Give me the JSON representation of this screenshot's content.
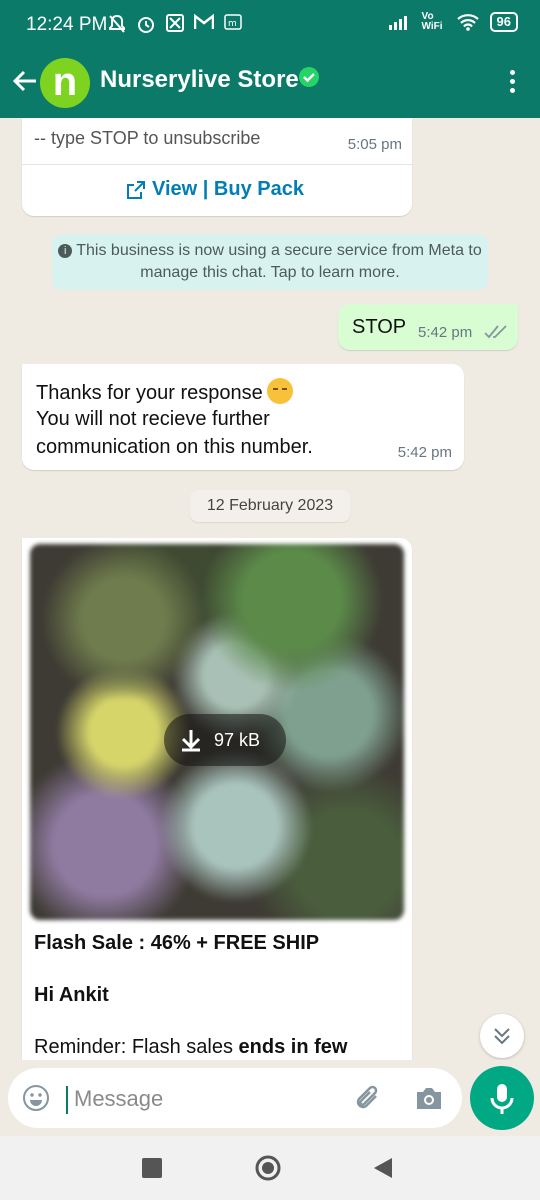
{
  "statusbar": {
    "time": "12:24 PM",
    "battery": "96",
    "left_icons": [
      "mute-icon",
      "alarm-icon",
      "app-icon",
      "gmail-icon",
      "m-icon"
    ],
    "right_icons": [
      "signal-icon",
      "vowifi-icon",
      "wifi-icon",
      "battery-icon"
    ],
    "network_label": "Vo WiFi"
  },
  "header": {
    "avatar_letter": "n",
    "title": "Nurserylive Store",
    "verified": true
  },
  "messages": {
    "unsub": {
      "text": "-- type STOP to unsubscribe",
      "time": "5:05 pm",
      "action_label": "View | Buy Pack"
    },
    "system_note": "This business is now using a secure service from Meta to manage this chat. Tap to learn more.",
    "stop": {
      "text": "STOP",
      "time": "5:42 pm"
    },
    "thanks": {
      "line1": "Thanks for your response",
      "line2": "You will not recieve further",
      "line3": "communication on this number.",
      "time": "5:42 pm"
    },
    "date_chip": "12 February 2023",
    "flash": {
      "download_size": "97 kB",
      "title": "Flash Sale : 46% + FREE SHIP",
      "greeting": "Hi Ankit",
      "reminder_prefix": "Reminder: Flash sales ",
      "reminder_bold": "ends in few"
    }
  },
  "input": {
    "placeholder": "Message"
  },
  "colors": {
    "header": "#0b7a68",
    "outgoing": "#d9fdd3",
    "link": "#027eb5",
    "mic": "#00a884",
    "avatar": "#7ed321"
  }
}
